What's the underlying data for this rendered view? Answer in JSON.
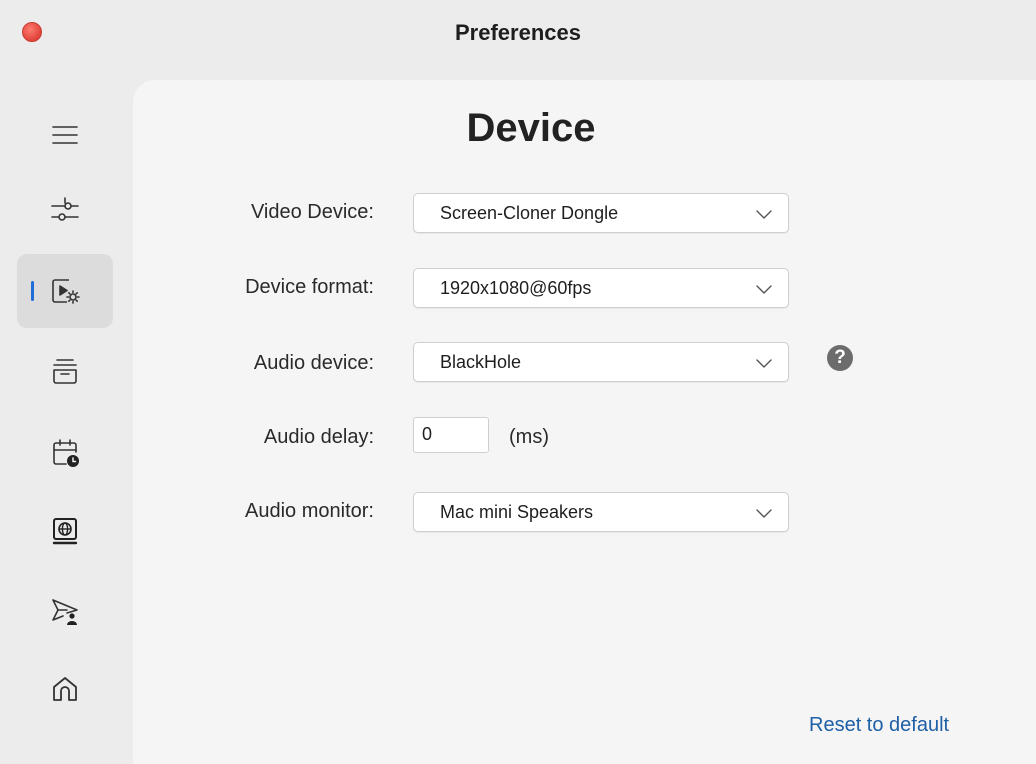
{
  "window": {
    "title": "Preferences"
  },
  "sidebar": {
    "items": [
      {
        "icon": "menu-icon",
        "active": false
      },
      {
        "icon": "sliders-icon",
        "active": false
      },
      {
        "icon": "video-settings-icon",
        "active": true
      },
      {
        "icon": "archive-icon",
        "active": false
      },
      {
        "icon": "calendar-clock-icon",
        "active": false
      },
      {
        "icon": "web-screen-icon",
        "active": false
      },
      {
        "icon": "send-user-icon",
        "active": false
      },
      {
        "icon": "home-icon",
        "active": false
      }
    ],
    "accent_color": "#1f6fd6"
  },
  "page": {
    "title": "Device",
    "video_device": {
      "label": "Video Device:",
      "value": "Screen-Cloner Dongle"
    },
    "device_format": {
      "label": "Device format:",
      "value": "1920x1080@60fps"
    },
    "audio_device": {
      "label": "Audio device:",
      "value": "BlackHole",
      "help_icon": "?"
    },
    "audio_delay": {
      "label": "Audio delay:",
      "value": "0",
      "unit": "(ms)"
    },
    "audio_monitor": {
      "label": "Audio monitor:",
      "value": "Mac mini Speakers"
    },
    "reset_label": "Reset to default",
    "link_color": "#1f5fa6"
  }
}
